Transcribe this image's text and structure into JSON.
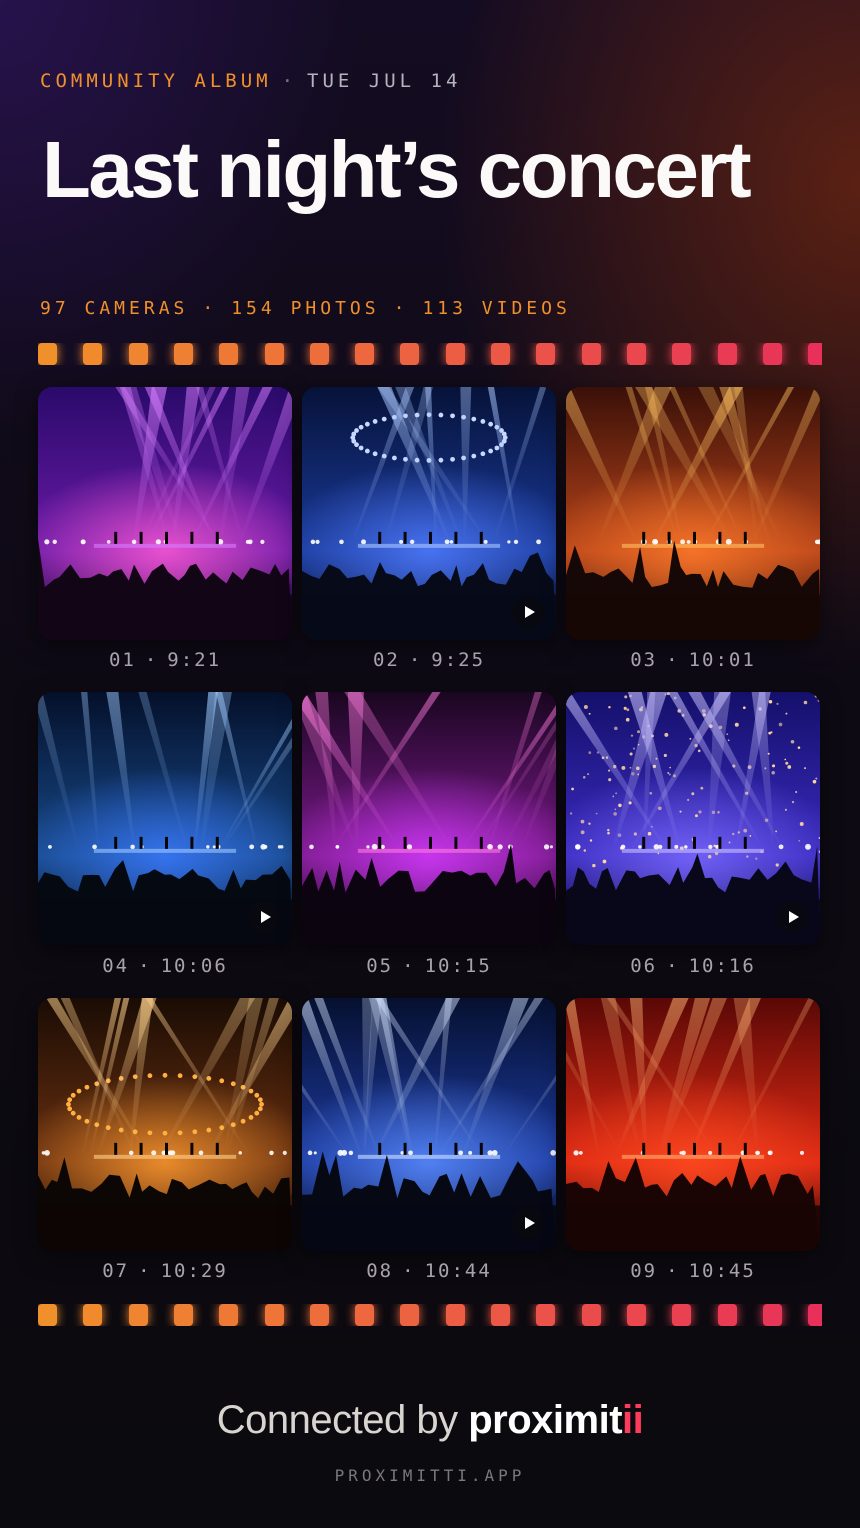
{
  "header": {
    "album_label": "COMMUNITY ALBUM",
    "separator": "·",
    "date": "TUE JUL 14",
    "title": "Last night’s concert"
  },
  "stats": {
    "cameras": "97 CAMERAS",
    "photos": "154 PHOTOS",
    "videos": "113 VIDEOS",
    "separator": "·"
  },
  "colors": {
    "accent_orange": "#f0902a",
    "accent_pink": "#e8305a",
    "brand_accent": "#ff3b5c"
  },
  "items": [
    {
      "number": "01",
      "time": "9:21",
      "is_video": false,
      "scene": "violet"
    },
    {
      "number": "02",
      "time": "9:25",
      "is_video": true,
      "scene": "blue-ring"
    },
    {
      "number": "03",
      "time": "10:01",
      "is_video": false,
      "scene": "amber"
    },
    {
      "number": "04",
      "time": "10:06",
      "is_video": true,
      "scene": "deep-blue"
    },
    {
      "number": "05",
      "time": "10:15",
      "is_video": false,
      "scene": "magenta"
    },
    {
      "number": "06",
      "time": "10:16",
      "is_video": true,
      "scene": "indigo-crowd"
    },
    {
      "number": "07",
      "time": "10:29",
      "is_video": false,
      "scene": "gold-ring"
    },
    {
      "number": "08",
      "time": "10:44",
      "is_video": true,
      "scene": "cobalt"
    },
    {
      "number": "09",
      "time": "10:45",
      "is_video": false,
      "scene": "red"
    }
  ],
  "footer": {
    "connected_text": "Connected by",
    "brand_main": "proximit",
    "brand_accent": "ii",
    "url": "PROXIMITTI.APP"
  }
}
